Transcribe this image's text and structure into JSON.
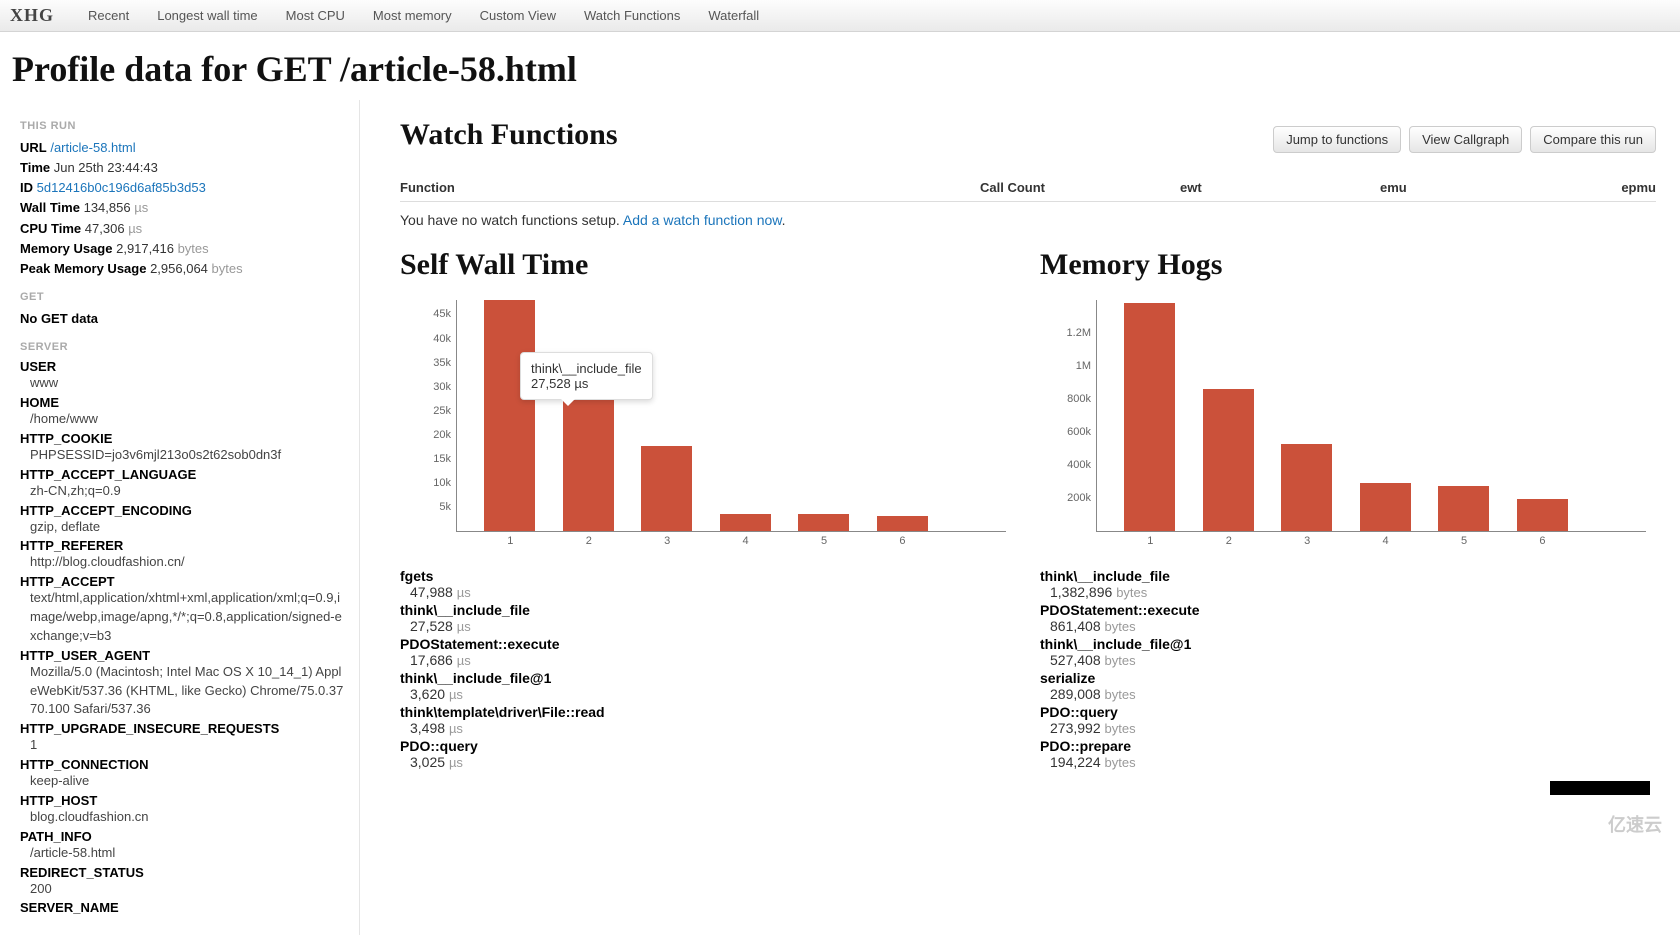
{
  "brand": "XHG",
  "nav": [
    "Recent",
    "Longest wall time",
    "Most CPU",
    "Most memory",
    "Custom View",
    "Watch Functions",
    "Waterfall"
  ],
  "page_title": "Profile data for GET /article-58.html",
  "sidebar": {
    "this_run_hdr": "THIS RUN",
    "url_label": "URL",
    "url_value": "/article-58.html",
    "time_label": "Time",
    "time_value": "Jun 25th 23:44:43",
    "id_label": "ID",
    "id_value": "5d12416b0c196d6af85b3d53",
    "wall_label": "Wall Time",
    "wall_value": "134,856",
    "wall_unit": "µs",
    "cpu_label": "CPU Time",
    "cpu_value": "47,306",
    "cpu_unit": "µs",
    "mem_label": "Memory Usage",
    "mem_value": "2,917,416",
    "mem_unit": "bytes",
    "peak_label": "Peak Memory Usage",
    "peak_value": "2,956,064",
    "peak_unit": "bytes",
    "get_hdr": "GET",
    "get_none": "No GET data",
    "server_hdr": "SERVER",
    "server": [
      {
        "k": "USER",
        "v": "www"
      },
      {
        "k": "HOME",
        "v": "/home/www"
      },
      {
        "k": "HTTP_COOKIE",
        "v": "PHPSESSID=jo3v6mjl213o0s2t62sob0dn3f"
      },
      {
        "k": "HTTP_ACCEPT_LANGUAGE",
        "v": "zh-CN,zh;q=0.9"
      },
      {
        "k": "HTTP_ACCEPT_ENCODING",
        "v": "gzip, deflate"
      },
      {
        "k": "HTTP_REFERER",
        "v": "http://blog.cloudfashion.cn/"
      },
      {
        "k": "HTTP_ACCEPT",
        "v": "text/html,application/xhtml+xml,application/xml;q=0.9,image/webp,image/apng,*/*;q=0.8,application/signed-exchange;v=b3"
      },
      {
        "k": "HTTP_USER_AGENT",
        "v": "Mozilla/5.0 (Macintosh; Intel Mac OS X 10_14_1) AppleWebKit/537.36 (KHTML, like Gecko) Chrome/75.0.3770.100 Safari/537.36"
      },
      {
        "k": "HTTP_UPGRADE_INSECURE_REQUESTS",
        "v": "1"
      },
      {
        "k": "HTTP_CONNECTION",
        "v": "keep-alive"
      },
      {
        "k": "HTTP_HOST",
        "v": "blog.cloudfashion.cn"
      },
      {
        "k": "PATH_INFO",
        "v": "/article-58.html"
      },
      {
        "k": "REDIRECT_STATUS",
        "v": "200"
      },
      {
        "k": "SERVER_NAME",
        "v": ""
      }
    ]
  },
  "watch": {
    "title": "Watch Functions",
    "btn_jump": "Jump to functions",
    "btn_callgraph": "View Callgraph",
    "btn_compare": "Compare this run",
    "cols": {
      "fn": "Function",
      "cc": "Call Count",
      "ewt": "ewt",
      "emu": "emu",
      "epmu": "epmu"
    },
    "none_msg": "You have no watch functions setup. ",
    "add_link": "Add a watch function now"
  },
  "selfwall": {
    "title": "Self Wall Time",
    "tooltip_name": "think\\__include_file",
    "tooltip_val": "27,528 µs",
    "list": [
      {
        "name": "fgets",
        "val": "47,988",
        "unit": "µs"
      },
      {
        "name": "think\\__include_file",
        "val": "27,528",
        "unit": "µs"
      },
      {
        "name": "PDOStatement::execute",
        "val": "17,686",
        "unit": "µs"
      },
      {
        "name": "think\\__include_file@1",
        "val": "3,620",
        "unit": "µs"
      },
      {
        "name": "think\\template\\driver\\File::read",
        "val": "3,498",
        "unit": "µs"
      },
      {
        "name": "PDO::query",
        "val": "3,025",
        "unit": "µs"
      }
    ]
  },
  "memhogs": {
    "title": "Memory Hogs",
    "list": [
      {
        "name": "think\\__include_file",
        "val": "1,382,896",
        "unit": "bytes"
      },
      {
        "name": "PDOStatement::execute",
        "val": "861,408",
        "unit": "bytes"
      },
      {
        "name": "think\\__include_file@1",
        "val": "527,408",
        "unit": "bytes"
      },
      {
        "name": "serialize",
        "val": "289,008",
        "unit": "bytes"
      },
      {
        "name": "PDO::query",
        "val": "273,992",
        "unit": "bytes"
      },
      {
        "name": "PDO::prepare",
        "val": "194,224",
        "unit": "bytes"
      }
    ]
  },
  "chart_data": [
    {
      "type": "bar",
      "title": "Self Wall Time",
      "categories": [
        "1",
        "2",
        "3",
        "4",
        "5",
        "6"
      ],
      "values": [
        47988,
        27528,
        17686,
        3620,
        3498,
        3025
      ],
      "y_ticks": [
        "5k",
        "10k",
        "15k",
        "20k",
        "25k",
        "30k",
        "35k",
        "40k",
        "45k"
      ],
      "ylim": [
        0,
        48000
      ],
      "ylabel": "",
      "xlabel": ""
    },
    {
      "type": "bar",
      "title": "Memory Hogs",
      "categories": [
        "1",
        "2",
        "3",
        "4",
        "5",
        "6"
      ],
      "values": [
        1382896,
        861408,
        527408,
        289008,
        273992,
        194224
      ],
      "y_ticks": [
        "200k",
        "400k",
        "600k",
        "800k",
        "1M",
        "1.2M"
      ],
      "ylim": [
        0,
        1400000
      ],
      "ylabel": "",
      "xlabel": ""
    }
  ],
  "watermark": "亿速云"
}
